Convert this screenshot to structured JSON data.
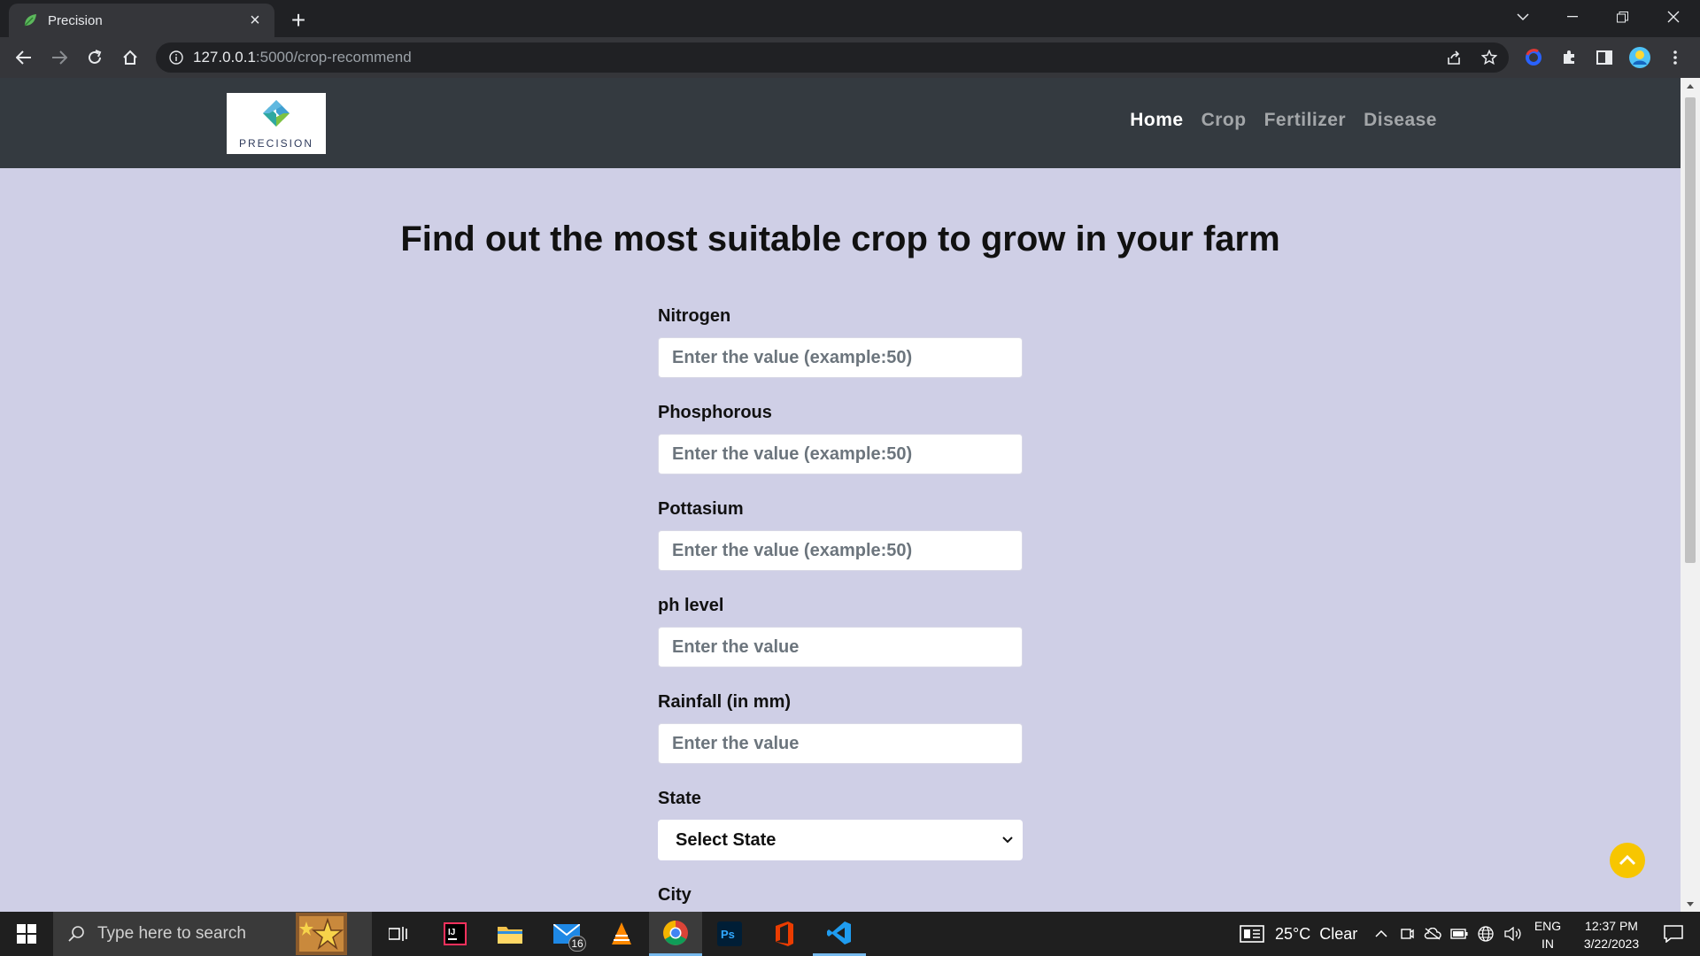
{
  "browser": {
    "tab_title": "Precision",
    "url_host": "127.0.0.1",
    "url_rest": ":5000/crop-recommend"
  },
  "site": {
    "logo_text": "PRECISION",
    "nav": [
      {
        "label": "Home",
        "active": true
      },
      {
        "label": "Crop",
        "active": false
      },
      {
        "label": "Fertilizer",
        "active": false
      },
      {
        "label": "Disease",
        "active": false
      }
    ],
    "heading": "Find out the most suitable crop to grow in your farm",
    "fields": [
      {
        "label": "Nitrogen",
        "placeholder": "Enter the value (example:50)"
      },
      {
        "label": "Phosphorous",
        "placeholder": "Enter the value (example:50)"
      },
      {
        "label": "Pottasium",
        "placeholder": "Enter the value (example:50)"
      },
      {
        "label": "ph level",
        "placeholder": "Enter the value"
      },
      {
        "label": "Rainfall (in mm)",
        "placeholder": "Enter the value"
      }
    ],
    "state_label": "State",
    "state_selected": "Select State",
    "city_label": "City"
  },
  "taskbar": {
    "search_placeholder": "Type here to search",
    "mail_badge": "16",
    "weather": "25°C  Clear",
    "lang_1": "ENG",
    "lang_2": "IN",
    "time": "12:37 PM",
    "date": "3/22/2023"
  },
  "colors": {
    "page_bg": "#cfcfe6",
    "navbar_bg": "#343a40",
    "scroll_top_btn": "#f7c600"
  }
}
